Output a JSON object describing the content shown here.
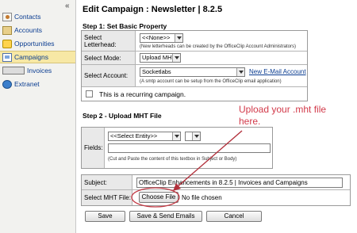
{
  "sidebar": {
    "collapse_label": "«",
    "items": [
      {
        "label": "Contacts"
      },
      {
        "label": "Accounts"
      },
      {
        "label": "Opportunities"
      },
      {
        "label": "Campaigns"
      },
      {
        "label": "Invoices"
      },
      {
        "label": "Extranet"
      }
    ]
  },
  "page_title": "Edit Campaign : Newsletter | 8.2.5",
  "step1": {
    "heading": "Step 1: Set Basic Property",
    "letterhead_label": "Select Letterhead:",
    "letterhead_value": "<<None>>",
    "letterhead_hint": "(New letterheads can be created by the OfficeClip Account Administrators)",
    "mode_label": "Select Mode:",
    "mode_value": "Upload MHT",
    "account_label": "Select Account:",
    "account_value": "Socketlabs",
    "new_account_link": "New E-Mail Account",
    "account_hint": "(A smtp account can be setup from the OfficeClip email application)",
    "recurring_label": "This is a recurring campaign."
  },
  "step2": {
    "heading": "Step 2 - Upload MHT File",
    "fields_label": "Fields:",
    "entity_value": "<<Select Entity>>",
    "field_value": "",
    "fields_hint": "(Cut and Paste the content of this textbox in Subject or Body)",
    "subject_label": "Subject:",
    "subject_value": "OfficeClip Enhancements in 8.2.5 | Invoices and Campaigns",
    "mht_label": "Select MHT File:",
    "choose_file_label": "Choose File",
    "no_file_text": "No file chosen"
  },
  "buttons": {
    "save": "Save",
    "save_send": "Save & Send Emails",
    "cancel": "Cancel"
  },
  "annotation": {
    "line1": "Upload your .mht file",
    "line2": "here.",
    "color": "#d23a4a"
  },
  "colors": {
    "nav_link": "#0b3d91",
    "active_nav_bg": "#f7e8a5",
    "label_bg": "#e9e9e9"
  }
}
